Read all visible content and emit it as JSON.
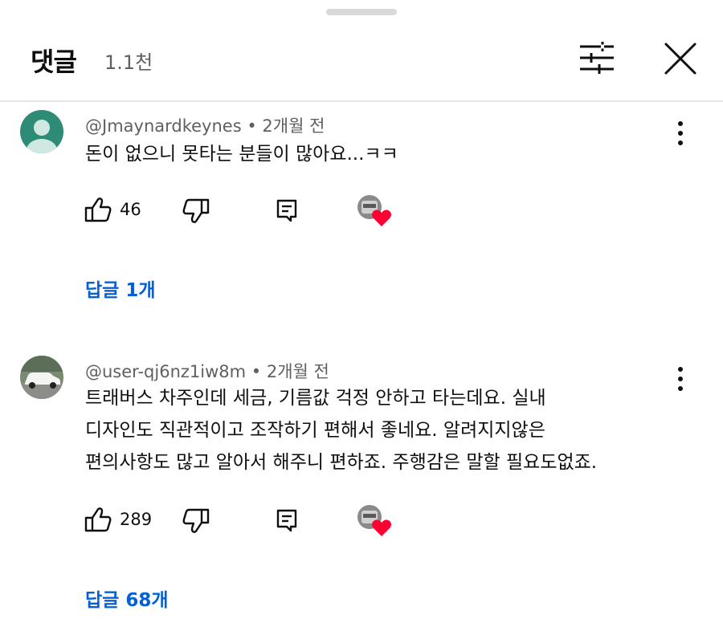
{
  "header": {
    "title": "댓글",
    "count": "1.1천"
  },
  "comments": [
    {
      "author": "@Jmaynardkeynes",
      "time": "2개월 전",
      "lines": [
        "돈이 없으니 못타는 분들이 많아요...ㅋㅋ"
      ],
      "likes": "46",
      "replies": "답글 1개",
      "avatar": "default-avatar"
    },
    {
      "author": "@user-qj6nz1iw8m",
      "time": "2개월 전",
      "lines": [
        "트래버스 차주인데 세금, 기름값 걱정 안하고 타는데요. 실내",
        "디자인도 직관적이고 조작하기 편해서 좋네요. 알려지지않은",
        "편의사항도 많고 알아서 해주니 편하죠. 주행감은 말할 필요도없죠."
      ],
      "likes": "289",
      "replies": "답글 68개",
      "avatar": "car-photo-avatar"
    }
  ],
  "meta_separator": "•",
  "colors": {
    "accent": "#065fd4",
    "heart": "#ff0033",
    "secondary_text": "#606060",
    "avatar_default": "#2e8b76"
  }
}
